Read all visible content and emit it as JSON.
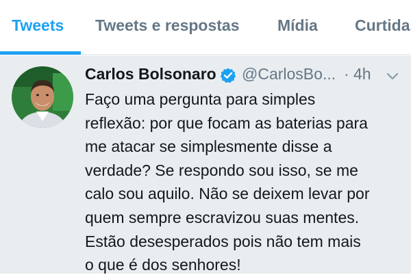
{
  "tabs": [
    {
      "label": "Tweets",
      "active": true
    },
    {
      "label": "Tweets e respostas",
      "active": false
    },
    {
      "label": "Mídia",
      "active": false
    },
    {
      "label": "Curtidas",
      "active": false
    }
  ],
  "tweet": {
    "display_name": "Carlos Bolsonaro",
    "verified": true,
    "handle": "@CarlosBo...",
    "separator": "·",
    "time": "4h",
    "text_lines": [
      "Faço uma pergunta para simples",
      "reflexão: por que focam as baterias para",
      "me atacar se simplesmente disse a",
      "verdade? Se respondo sou isso, se me",
      "calo sou aquilo. Não se deixem levar por",
      "quem sempre escravizou suas mentes.",
      "Estão desesperados pois não tem mais",
      "o que é dos senhores!"
    ]
  },
  "colors": {
    "accent": "#1da1f2",
    "tab_inactive": "#657786",
    "text": "#14171a",
    "tweet_background": "#e9edf0"
  },
  "icons": {
    "verified": "verified-badge-icon",
    "menu": "chevron-down-icon"
  }
}
